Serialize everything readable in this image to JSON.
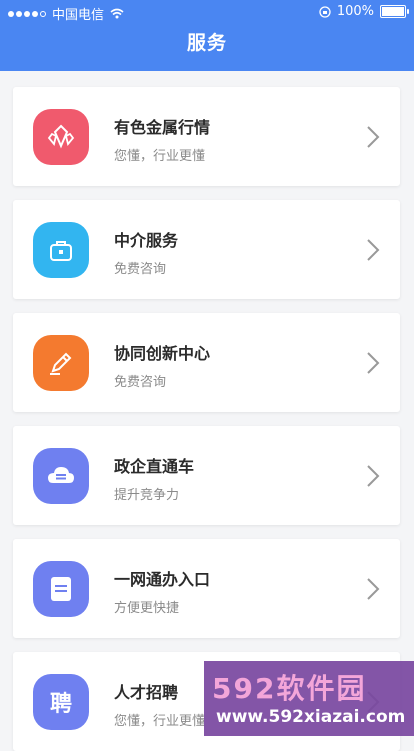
{
  "status_bar": {
    "carrier": "中国电信",
    "battery": "100%"
  },
  "header": {
    "title": "服务"
  },
  "services": [
    {
      "title": "有色金属行情",
      "subtitle": "您懂，行业更懂",
      "icon": "crystals-icon",
      "color": "#f05a6d"
    },
    {
      "title": "中介服务",
      "subtitle": "免费咨询",
      "icon": "briefcase-icon",
      "color": "#32b5f0"
    },
    {
      "title": "协同创新中心",
      "subtitle": "免费咨询",
      "icon": "pencil-icon",
      "color": "#f47a2f"
    },
    {
      "title": "政企直通车",
      "subtitle": "提升竞争力",
      "icon": "cloud-icon",
      "color": "#6f80f0"
    },
    {
      "title": "一网通办入口",
      "subtitle": "方便更快捷",
      "icon": "document-icon",
      "color": "#6f80f0"
    },
    {
      "title": "人才招聘",
      "subtitle": "您懂，行业更懂",
      "icon": "recruit-char-icon",
      "icon_char": "聘",
      "color": "#6f80f0"
    }
  ],
  "watermark": {
    "brand": "592软件园",
    "url": "www.592xiazai.com"
  }
}
